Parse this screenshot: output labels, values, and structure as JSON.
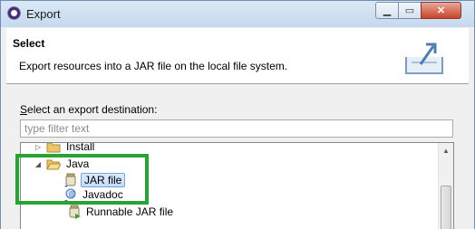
{
  "window": {
    "title": "Export"
  },
  "banner": {
    "title": "Select",
    "description": "Export resources into a JAR file on the local file system.",
    "icon": "export-arrow-icon"
  },
  "content": {
    "destination_label_mnemonic": "S",
    "destination_label_rest": "elect an export destination:",
    "filter_placeholder": "type filter text"
  },
  "tree": {
    "items": [
      {
        "label": "Install",
        "icon": "folder-icon",
        "expanded": false
      },
      {
        "label": "Java",
        "icon": "folder-open-icon",
        "expanded": true
      },
      {
        "label": "JAR file",
        "icon": "jar-icon",
        "selected": true
      },
      {
        "label": "Javadoc",
        "icon": "javadoc-icon"
      },
      {
        "label": "Runnable JAR file",
        "icon": "runnable-jar-icon"
      }
    ]
  },
  "colors": {
    "highlight_border": "#29a338",
    "selection": "#c1dbfc"
  }
}
